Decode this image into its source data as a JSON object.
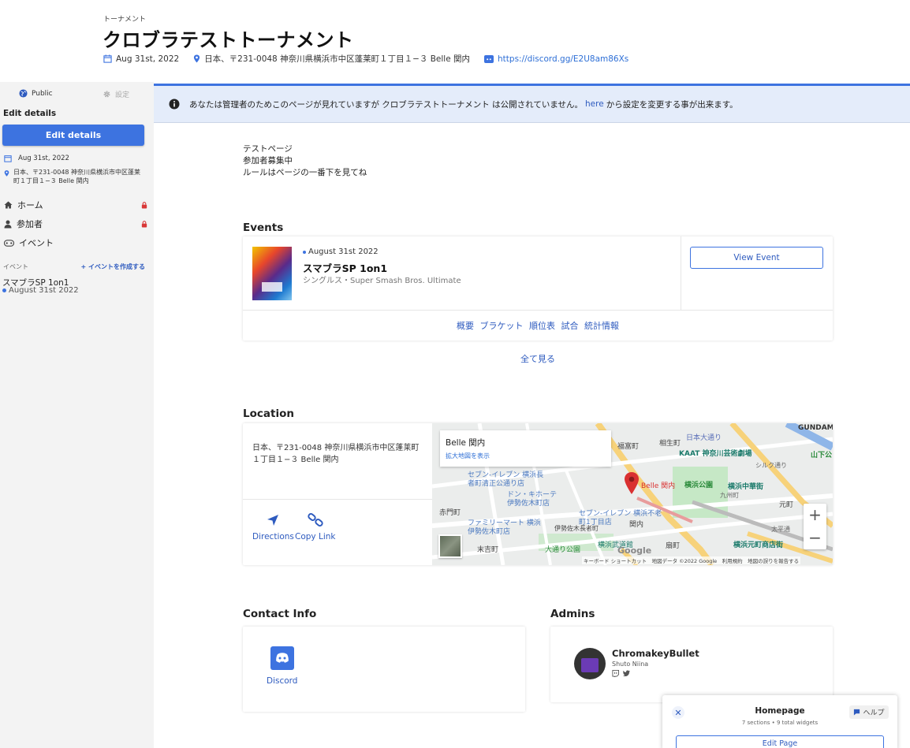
{
  "header": {
    "label": "トーナメント",
    "title": "クロブラテストトーナメント",
    "date": "Aug 31st, 2022",
    "address": "日本、〒231-0048 神奈川県横浜市中区蓬莱町１丁目１−３ Belle 関内",
    "discord": "https://discord.gg/E2U8am86Xs"
  },
  "sidebar": {
    "visibility": "Public",
    "settings": "設定",
    "edit_heading": "Edit details",
    "edit_button": "Edit details",
    "date": "Aug 31st, 2022",
    "address": "日本、〒231-0048 神奈川県横浜市中区蓬莱町１丁目１−３ Belle 関内",
    "nav": [
      {
        "label": "ホーム",
        "icon": "home-icon",
        "locked": true
      },
      {
        "label": "参加者",
        "icon": "user-icon",
        "locked": true
      },
      {
        "label": "イベント",
        "icon": "gamepad-icon",
        "locked": false
      }
    ],
    "events_label": "イベント",
    "create_event": "+ イベントを作成する",
    "event_name": "スマブラSP 1on1",
    "event_date": "August 31st 2022"
  },
  "banner": {
    "before": "あなたは管理者のためこのページが見れていますが クロブラテストトーナメント は公開されていません。",
    "link": "here",
    "after": "から設定を変更する事が出来ます。"
  },
  "description": [
    "テストページ",
    "参加者募集中",
    "ルールはページの一番下を見てね"
  ],
  "events": {
    "title": "Events",
    "date": "August 31st 2022",
    "name": "スマブラSP 1on1",
    "game": "シングルス・Super Smash Bros. Ultimate",
    "view_button": "View Event",
    "links": [
      "概要",
      "ブラケット",
      "順位表",
      "試合",
      "統計情報"
    ],
    "see_all": "全て見る"
  },
  "location": {
    "title": "Location",
    "address": "日本、〒231-0048 神奈川県横浜市中区蓬莱町１丁目１−３ Belle 関内",
    "directions": "Directions",
    "copy_link": "Copy Link",
    "map": {
      "place_name": "Belle 関内",
      "enlarge": "拡大地図を表示",
      "pin_label": "Belle 関内",
      "footer": "キーボード ショートカット　地図データ ©2022 Google　利用規約　地図の誤りを報告する",
      "logo": "Google",
      "labels": [
        {
          "text": "日本大通り",
          "color": "#5a6fb8"
        },
        {
          "text": "相生町",
          "color": "#444"
        },
        {
          "text": "KAAT 神奈川芸術劇場",
          "color": "#1a7a6a"
        },
        {
          "text": "横浜公園",
          "color": "#2a8a3a"
        },
        {
          "text": "横浜中華街",
          "color": "#1a7a6a"
        },
        {
          "text": "セブン-イレブン 横浜長者町清正公通り店",
          "color": "#4a78c0"
        },
        {
          "text": "ドン・キホーテ 伊勢佐木町店",
          "color": "#4a78c0"
        },
        {
          "text": "赤門町",
          "color": "#444"
        },
        {
          "text": "ファミリーマート 横浜伊勢佐木町店",
          "color": "#4a78c0"
        },
        {
          "text": "セブン-イレブン 横浜不老町1丁目店",
          "color": "#4a78c0"
        },
        {
          "text": "伊勢佐木長者町",
          "color": "#444"
        },
        {
          "text": "大通り公園",
          "color": "#2a8a3a"
        },
        {
          "text": "横浜武道館",
          "color": "#1a7a6a"
        },
        {
          "text": "末吉町",
          "color": "#444"
        },
        {
          "text": "扇町",
          "color": "#444"
        },
        {
          "text": "横浜元町商店街",
          "color": "#1a7a6a"
        },
        {
          "text": "GUNDAM",
          "color": "#333"
        },
        {
          "text": "山下公",
          "color": "#2a8a3a"
        },
        {
          "text": "元町",
          "color": "#444"
        },
        {
          "text": "九州町",
          "color": "#666"
        },
        {
          "text": "シルク通り",
          "color": "#666"
        },
        {
          "text": "太平通",
          "color": "#666"
        },
        {
          "text": "関内",
          "color": "#444"
        },
        {
          "text": "福富町",
          "color": "#444"
        }
      ]
    }
  },
  "contact": {
    "title": "Contact Info",
    "discord": "Discord"
  },
  "admins": {
    "title": "Admins",
    "name": "ChromakeyBullet",
    "realname": "Shuto Niina"
  },
  "float_panel": {
    "title": "Homepage",
    "subtitle": "7 sections • 9 total widgets",
    "help": "ヘルプ",
    "edit": "Edit Page"
  },
  "colors": {
    "accent": "#3d73e0",
    "link": "#2e5bbf",
    "banner_bg": "#e4ecfa",
    "lock": "#d93838",
    "map_pin": "#d93030"
  }
}
